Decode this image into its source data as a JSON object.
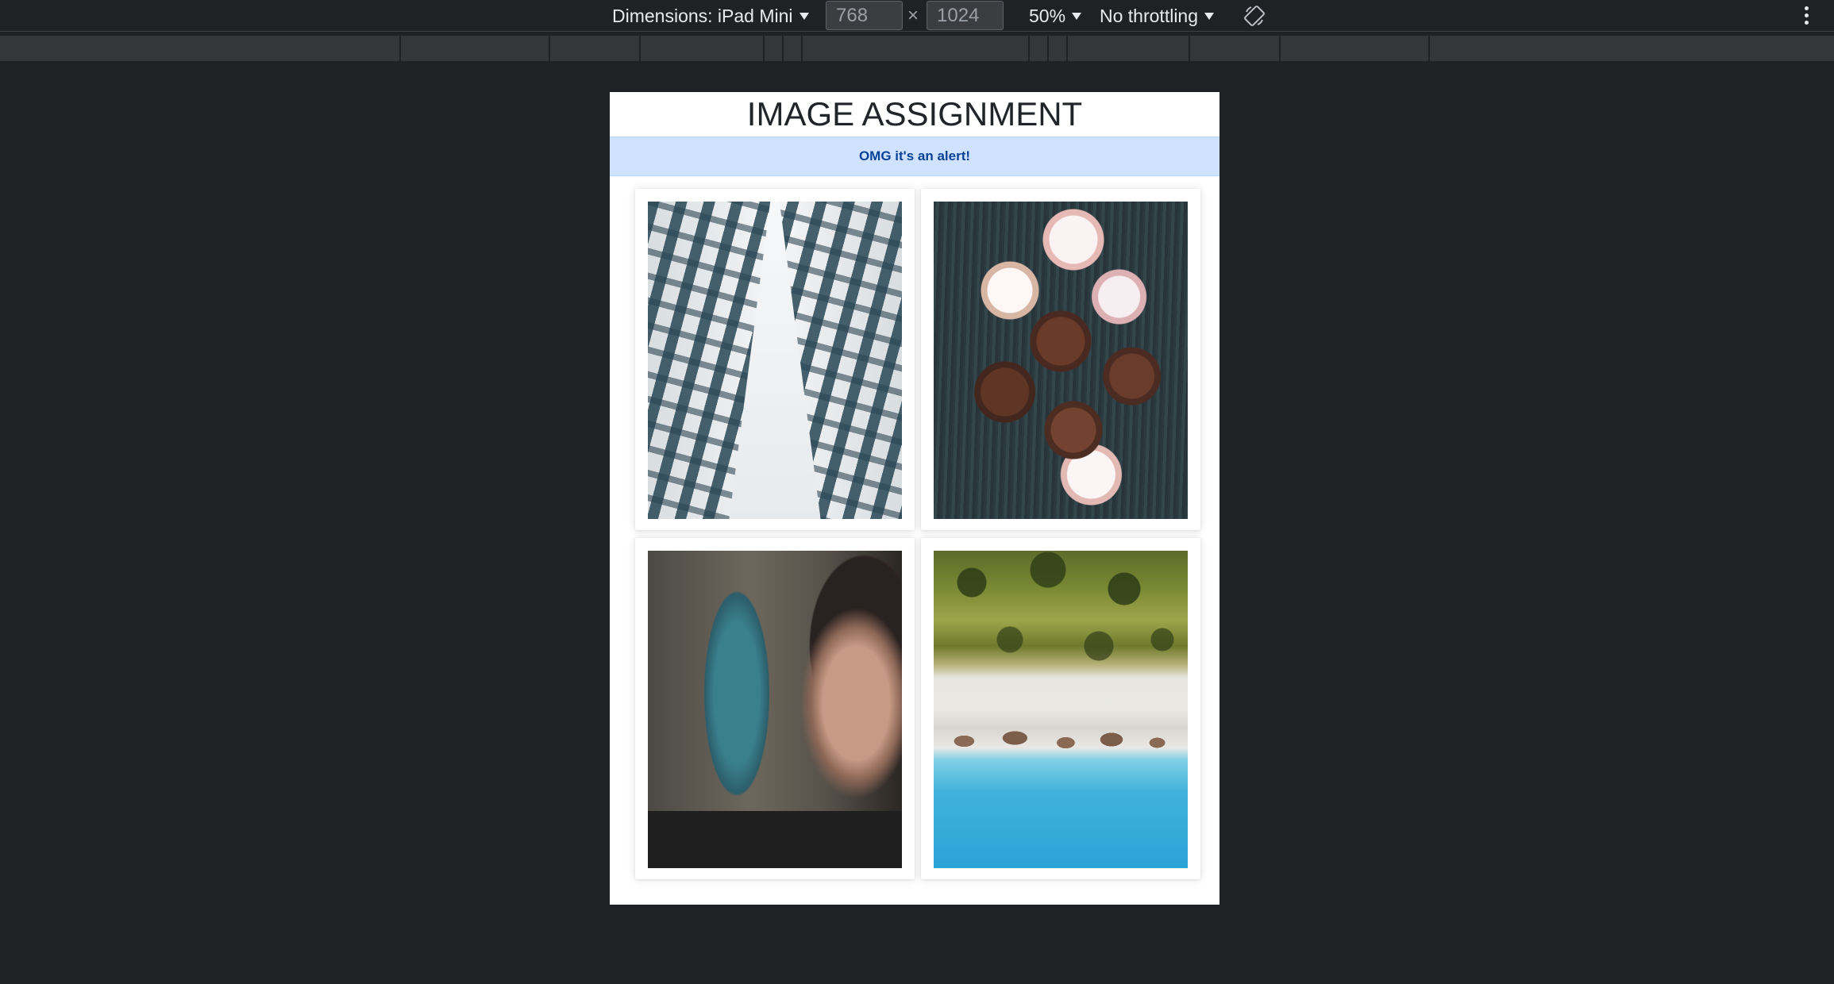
{
  "toolbar": {
    "dimensions_label": "Dimensions: iPad Mini",
    "width_value": "768",
    "height_value": "1024",
    "times_symbol": "×",
    "zoom_label": "50%",
    "throttling_label": "No throttling"
  },
  "page": {
    "title": "IMAGE ASSIGNMENT",
    "alert_text": "OMG it's an alert!",
    "images": [
      {
        "name": "building-photo"
      },
      {
        "name": "cupcakes-photo"
      },
      {
        "name": "graffiti-photo"
      },
      {
        "name": "beach-photo"
      }
    ]
  },
  "colors": {
    "devtools_bg": "#202124",
    "alert_bg": "#cfe2ff",
    "alert_text": "#084298",
    "title_text": "#212529"
  }
}
